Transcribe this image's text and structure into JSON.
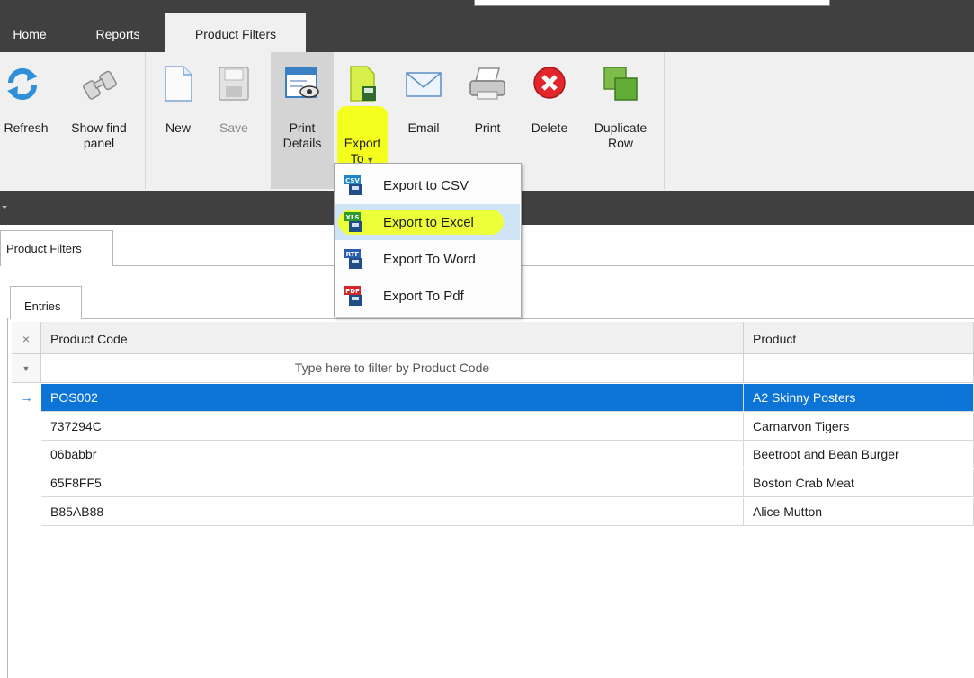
{
  "menu": {
    "tabs": [
      {
        "label": "Home"
      },
      {
        "label": "Reports"
      },
      {
        "label": "Product  Filters"
      }
    ]
  },
  "ribbon": {
    "buttons": [
      {
        "label": "Refresh",
        "icon": "refresh-icon"
      },
      {
        "label": "Show find\npanel",
        "icon": "binoculars-icon"
      },
      {
        "label": "New",
        "icon": "new-document-icon"
      },
      {
        "label": "Save",
        "icon": "save-icon",
        "disabled": true
      },
      {
        "label": "Print\nDetails",
        "icon": "print-preview-icon",
        "pressed": true
      },
      {
        "label": "Export\nTo",
        "icon": "export-icon"
      },
      {
        "label": "Email",
        "icon": "envelope-icon"
      },
      {
        "label": "Print",
        "icon": "printer-icon"
      },
      {
        "label": "Delete",
        "icon": "delete-icon"
      },
      {
        "label": "Duplicate\nRow",
        "icon": "duplicate-icon"
      }
    ]
  },
  "export_menu": {
    "items": [
      {
        "label": "Export to CSV",
        "icon": "csv-file-icon",
        "badge": "CSV",
        "badge_color": "#1b86c8"
      },
      {
        "label": "Export to Excel",
        "icon": "xls-file-icon",
        "badge": "XLS",
        "badge_color": "#2c9a2c",
        "highlighted": true
      },
      {
        "label": "Export To Word",
        "icon": "rtf-file-icon",
        "badge": "RTF",
        "badge_color": "#2a5eb5"
      },
      {
        "label": "Export To Pdf",
        "icon": "pdf-file-icon",
        "badge": "PDF",
        "badge_color": "#d0262b"
      }
    ]
  },
  "document_tab": {
    "label": "Product  Filters"
  },
  "inner_tab": {
    "label": "Entries"
  },
  "grid": {
    "columns": [
      "Product Code",
      "Product"
    ],
    "filter_placeholder": "Type here to filter by Product Code",
    "rows": [
      {
        "code": "POS002",
        "product": "A2 Skinny Posters",
        "selected": true
      },
      {
        "code": "737294C",
        "product": "Carnarvon Tigers"
      },
      {
        "code": "06babbr",
        "product": "Beetroot and Bean Burger"
      },
      {
        "code": "65F8FF5",
        "product": "Boston Crab Meat"
      },
      {
        "code": "B85AB88",
        "product": "Alice Mutton"
      }
    ],
    "symbols": {
      "clear": "×",
      "filter": "▼",
      "current_row": "→"
    }
  },
  "colors": {
    "selection": "#0b74d6",
    "highlighter": "#f4ff1e",
    "dark_chrome": "#404040"
  }
}
